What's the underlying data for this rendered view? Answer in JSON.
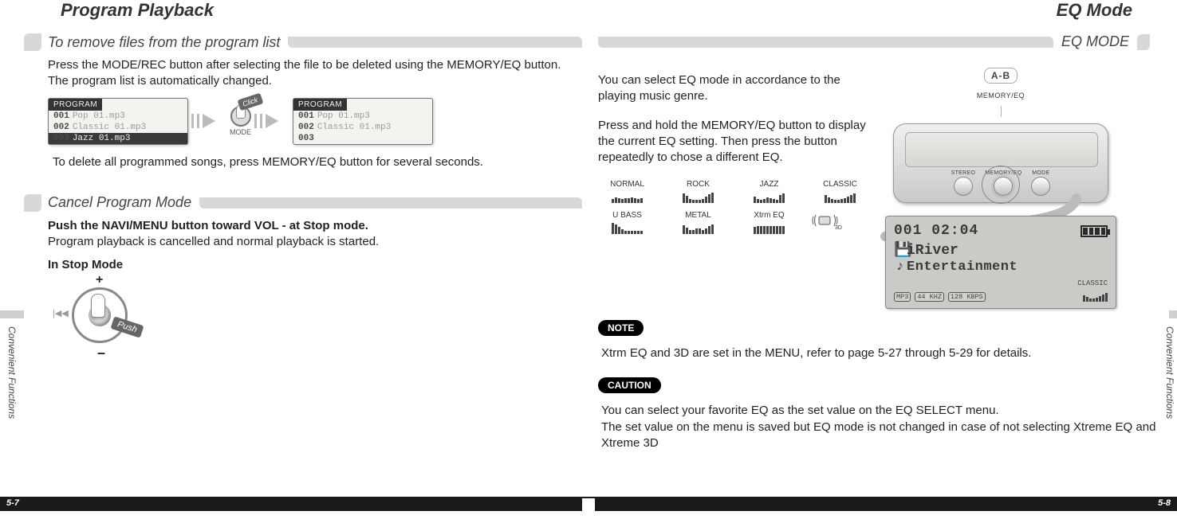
{
  "left": {
    "title": "Program Playback",
    "side_label": "Convenient Functions",
    "page_no": "5-7",
    "sec1": {
      "heading": "To remove files from the program list",
      "para": "Press the MODE/REC button after selecting the file to be deleted using the MEMORY/EQ button.  The program list is automatically changed.",
      "lcd_label": "PROGRAM",
      "list_before": [
        {
          "idx": "001",
          "name": "Pop 01.mp3"
        },
        {
          "idx": "002",
          "name": "Classic 01.mp3"
        },
        {
          "idx": "003",
          "name": "Jazz 01.mp3"
        }
      ],
      "list_after": [
        {
          "idx": "001",
          "name": "Pop 01.mp3"
        },
        {
          "idx": "002",
          "name": "Classic 01.mp3"
        },
        {
          "idx": "003",
          "name": ""
        }
      ],
      "mode_caption": "MODE",
      "click_tag": "Click",
      "para2": "To delete all programmed songs, press MEMORY/EQ button for several seconds."
    },
    "sec2": {
      "heading": "Cancel Program Mode",
      "bold": "Push the NAVI/MENU button toward VOL - at Stop mode.",
      "para": "Program playback is cancelled and normal playback is started.",
      "subhead": "In Stop Mode",
      "push_tag": "Push"
    }
  },
  "right": {
    "title": "EQ Mode",
    "side_label": "Convenient Functions",
    "page_no": "5-8",
    "sec": {
      "heading": "EQ MODE",
      "para1": "You can select EQ mode in accordance to the playing music genre.",
      "para2": "Press and hold the MEMORY/EQ button to display the current EQ setting. Then press the button repeatedly to chose a different EQ.",
      "ab_label": "A-B",
      "mem_label": "MEMORY/EQ",
      "player_buttons": [
        "STEREO",
        "MEMORY/EQ",
        "MODE"
      ],
      "eq_names": [
        "NORMAL",
        "ROCK",
        "JAZZ",
        "CLASSIC",
        "U BASS",
        "METAL",
        "Xtrm EQ",
        "3D"
      ],
      "lcd": {
        "track_time": "001 02:04",
        "line1": "iRiver",
        "line2": "Entertainment",
        "chips": [
          "MP3",
          "44 KHZ",
          "128 KBPS"
        ],
        "footer_eq": "CLASSIC"
      },
      "note_label": "NOTE",
      "note_text": "Xtrm EQ and 3D are set in the MENU, refer to page 5-27 through 5-29 for details.",
      "caution_label": "CAUTION",
      "caution_text": "You can select your favorite EQ as the set value on the EQ SELECT menu.\nThe set value on the menu is saved but EQ mode is not changed in case of not selecting Xtreme EQ and Xtreme 3D"
    }
  }
}
